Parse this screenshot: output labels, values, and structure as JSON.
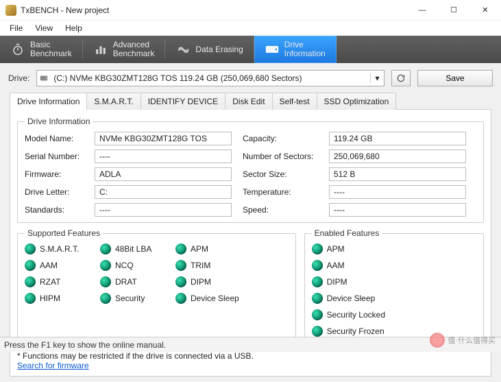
{
  "window": {
    "title": "TxBENCH - New project",
    "min": "—",
    "max": "☐",
    "close": "✕"
  },
  "menubar": {
    "file": "File",
    "view": "View",
    "help": "Help"
  },
  "toolbar": {
    "basic": "Basic\nBenchmark",
    "advanced": "Advanced\nBenchmark",
    "erase": "Data Erasing",
    "info": "Drive\nInformation"
  },
  "drivebar": {
    "label": "Drive:",
    "selected": "(C:) NVMe KBG30ZMT128G TOS  119.24 GB (250,069,680 Sectors)",
    "save": "Save"
  },
  "tabs": {
    "driveinfo": "Drive Information",
    "smart": "S.M.A.R.T.",
    "identify": "IDENTIFY DEVICE",
    "diskedit": "Disk Edit",
    "selftest": "Self-test",
    "ssdopt": "SSD Optimization"
  },
  "fs_info": {
    "legend": "Drive Information",
    "labels": {
      "model": "Model Name:",
      "serial": "Serial Number:",
      "firmware": "Firmware:",
      "letter": "Drive Letter:",
      "standards": "Standards:",
      "capacity": "Capacity:",
      "sectors": "Number of Sectors:",
      "sectorsize": "Sector Size:",
      "temperature": "Temperature:",
      "speed": "Speed:"
    },
    "values": {
      "model": "NVMe KBG30ZMT128G TOS",
      "serial": "----",
      "firmware": "ADLA",
      "letter": "C:",
      "standards": "----",
      "capacity": "119.24 GB",
      "sectors": "250,069,680",
      "sectorsize": "512 B",
      "temperature": "----",
      "speed": "----"
    }
  },
  "supported": {
    "legend": "Supported Features",
    "items": [
      "S.M.A.R.T.",
      "48Bit LBA",
      "APM",
      "AAM",
      "NCQ",
      "TRIM",
      "RZAT",
      "DRAT",
      "DIPM",
      "HIPM",
      "Security",
      "Device Sleep"
    ]
  },
  "enabled": {
    "legend": "Enabled Features",
    "items": [
      "APM",
      "AAM",
      "DIPM",
      "Device Sleep",
      "Security Locked",
      "Security Frozen"
    ]
  },
  "footnote": {
    "note": "* Functions may be restricted if the drive is connected via a USB.",
    "link": "Search for firmware"
  },
  "status": "Press the F1 key to show the online manual.",
  "watermark": "值·什么值得买"
}
